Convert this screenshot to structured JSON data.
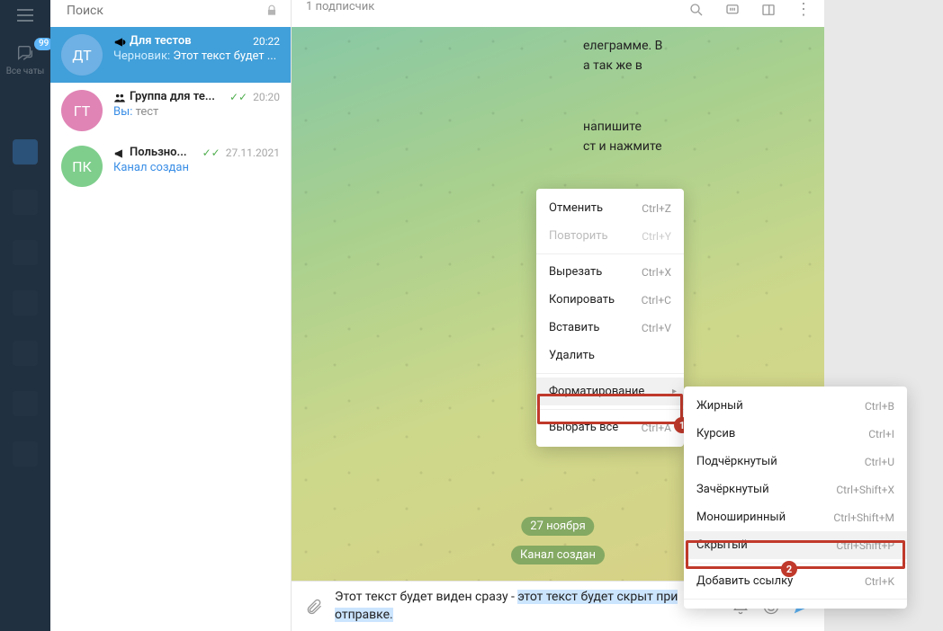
{
  "far_sidebar": {
    "badge": "99",
    "chats_label": "Все чаты"
  },
  "search": {
    "placeholder": "Поиск"
  },
  "chats": [
    {
      "avatar": "ДТ",
      "name": "Для тестов",
      "time": "20:22",
      "draft_label": "Черновик:",
      "sub": "Этот текст будет ...",
      "type": "channel"
    },
    {
      "avatar": "ГТ",
      "name": "Группа для те...",
      "time": "20:20",
      "you_label": "Вы:",
      "sub": "тест",
      "checks": true,
      "type": "group"
    },
    {
      "avatar": "ПК",
      "name": "Пользно...",
      "time": "27.11.2021",
      "sub": "Канал создан",
      "checks": true,
      "type": "channel",
      "created": true
    }
  ],
  "main": {
    "subscribers": "1 подписчик",
    "bg_lines": [
      "елеграмме. В",
      "а так же в",
      "",
      "напишите",
      "ст и нажмите"
    ],
    "date_pill": "27 ноября",
    "chan_pill": "Канал создан",
    "input_plain": "Этот текст будет виден сразу - ",
    "input_sel": "этот текст будет скрыт при отправке."
  },
  "ctx1": [
    {
      "label": "Отменить",
      "shortcut": "Ctrl+Z"
    },
    {
      "label": "Повторить",
      "shortcut": "Ctrl+Y",
      "disabled": true
    },
    {
      "sep": true
    },
    {
      "label": "Вырезать",
      "shortcut": "Ctrl+X"
    },
    {
      "label": "Копировать",
      "shortcut": "Ctrl+C"
    },
    {
      "label": "Вставить",
      "shortcut": "Ctrl+V"
    },
    {
      "label": "Удалить"
    },
    {
      "sep": true
    },
    {
      "label": "Форматирование",
      "submenu": true,
      "hover": true
    },
    {
      "sep": true
    },
    {
      "label": "Выбрать всё",
      "shortcut": "Ctrl+A"
    }
  ],
  "ctx2": [
    {
      "label": "Жирный",
      "shortcut": "Ctrl+B"
    },
    {
      "label": "Курсив",
      "shortcut": "Ctrl+I"
    },
    {
      "label": "Подчёркнутый",
      "shortcut": "Ctrl+U"
    },
    {
      "label": "Зачёркнутый",
      "shortcut": "Ctrl+Shift+X"
    },
    {
      "label": "Моноширинный",
      "shortcut": "Ctrl+Shift+M"
    },
    {
      "label": "Скрытый",
      "shortcut": "Ctrl+Shift+P",
      "sel": true
    },
    {
      "sep": true
    },
    {
      "label": "Добавить ссылку",
      "shortcut": "Ctrl+K"
    },
    {
      "sep": true
    }
  ],
  "badges": {
    "b1": "1",
    "b2": "2"
  }
}
